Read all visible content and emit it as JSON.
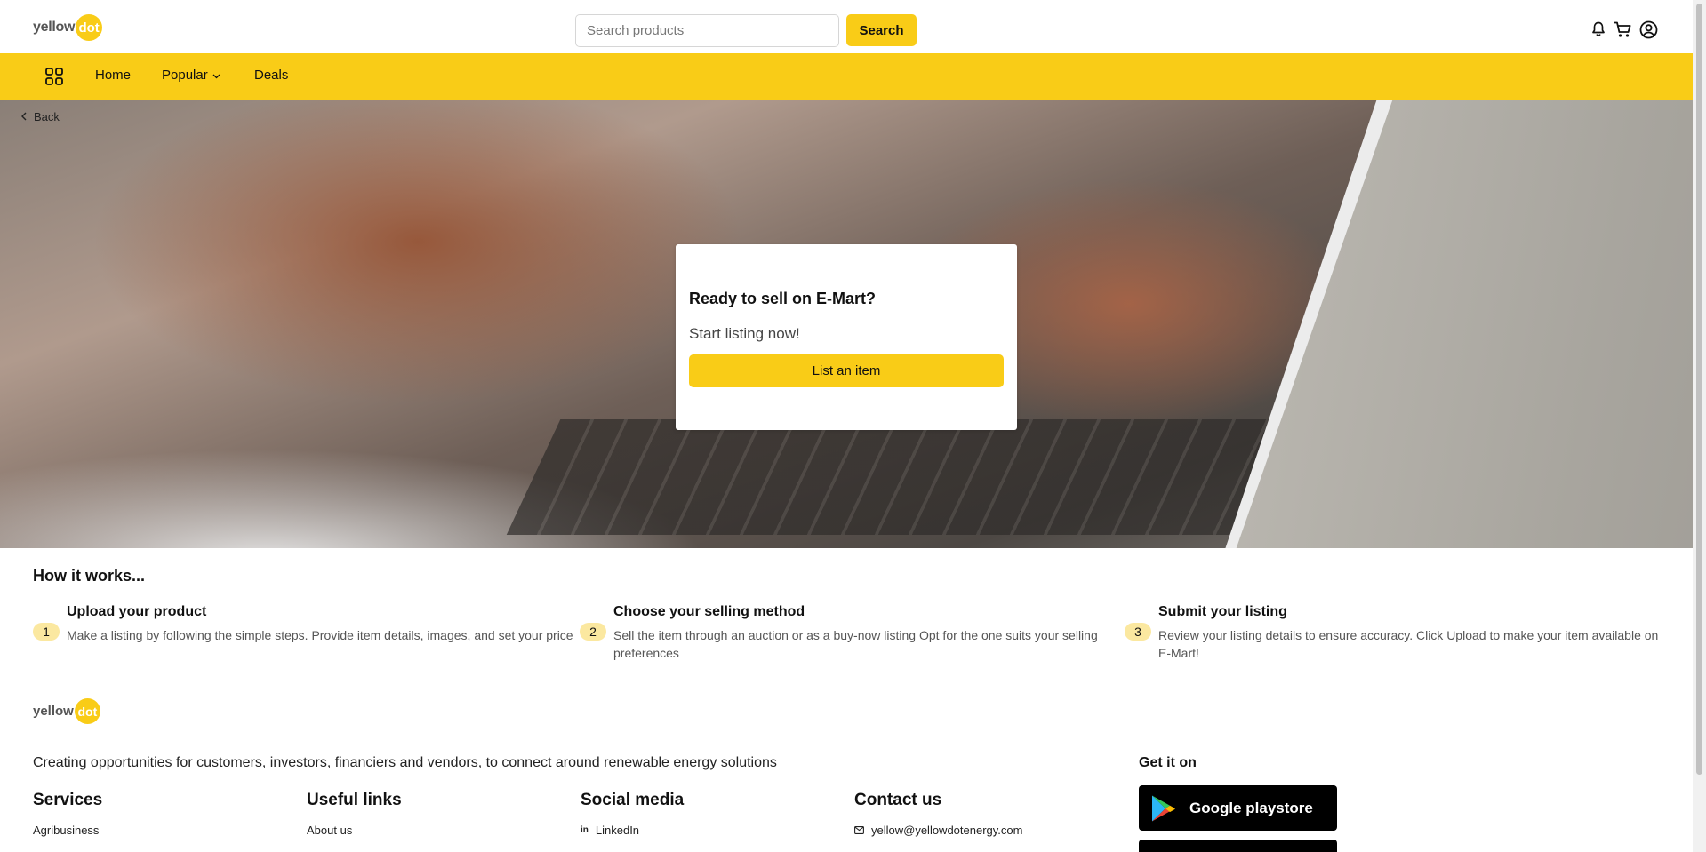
{
  "header": {
    "logo_word": "yellow",
    "logo_dot": "dot",
    "search_placeholder": "Search products",
    "search_button": "Search",
    "icons": [
      "bell-icon",
      "cart-icon",
      "account-icon"
    ]
  },
  "nav": {
    "items": [
      {
        "label": "Home"
      },
      {
        "label": "Popular"
      },
      {
        "label": "Deals"
      }
    ]
  },
  "hero": {
    "back_label": "Back",
    "card_title": "Ready to sell on E-Mart?",
    "card_subtitle": "Start listing now!",
    "card_button": "List an item"
  },
  "how_it_works": {
    "title": "How it works...",
    "steps": [
      {
        "number": "1",
        "title": "Upload your product",
        "description": "Make a listing by following the simple steps. Provide item details, images, and set your price"
      },
      {
        "number": "2",
        "title": "Choose your selling method",
        "description": "Sell the item through an auction or as a buy-now listing Opt for the one suits your selling preferences"
      },
      {
        "number": "3",
        "title": "Submit your listing",
        "description": "Review your listing details to ensure accuracy. Click Upload to make your item available on E-Mart!"
      }
    ]
  },
  "footer": {
    "logo_word": "yellow",
    "logo_dot": "dot",
    "tagline": "Creating opportunities for customers, investors, financiers and vendors, to connect around renewable energy solutions",
    "columns": [
      {
        "title": "Services",
        "first_link": "Agribusiness"
      },
      {
        "title": "Useful links",
        "first_link": "About us"
      },
      {
        "title": "Social media",
        "first_link": "LinkedIn"
      },
      {
        "title": "Contact us",
        "first_link": "yellow@yellowdotenergy.com"
      }
    ],
    "get_it_on": "Get it on",
    "google_play": "Google playstore"
  },
  "colors": {
    "accent": "#f9cc17",
    "badge": "#fbe8a0"
  }
}
